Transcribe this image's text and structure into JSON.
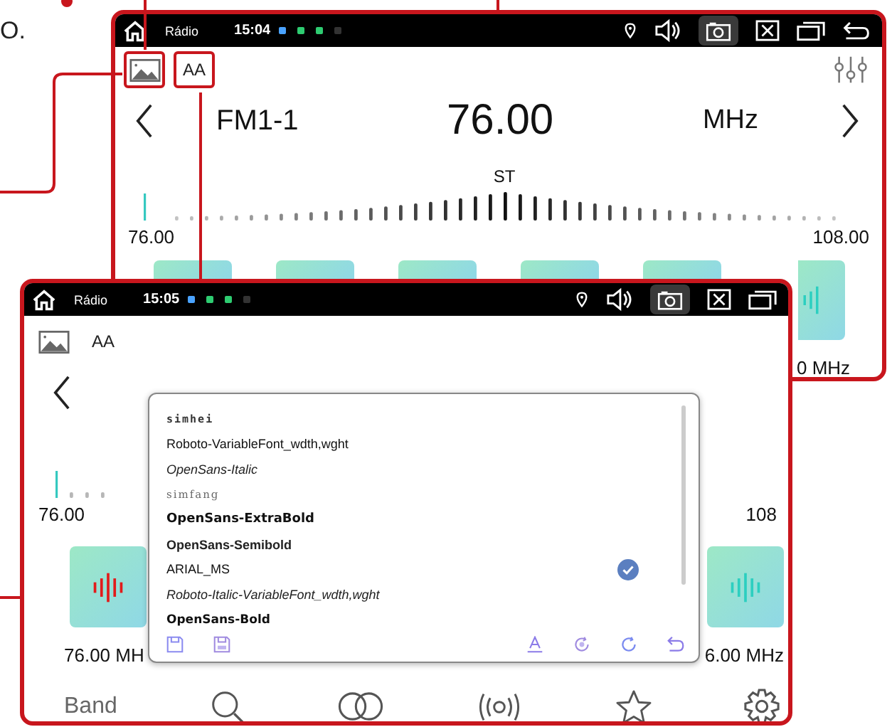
{
  "page_fragment": "O.",
  "back_screen": {
    "status_bar": {
      "app": "Rádio",
      "time": "15:04",
      "icons": [
        {
          "kind": "location"
        },
        {
          "kind": "volume"
        },
        {
          "kind": "camera"
        },
        {
          "kind": "close"
        },
        {
          "kind": "windows"
        },
        {
          "kind": "back"
        }
      ]
    },
    "toolbar": {
      "image_highlighted": true,
      "font_button": "AA",
      "font_highlighted": true
    },
    "band": "FM1-1",
    "frequency": "76.00",
    "unit": "MHz",
    "stereo": "ST",
    "scale": {
      "min": "76.00",
      "max": "108.00",
      "level": 0
    },
    "presets": [
      {
        "kind": "strip"
      },
      {
        "kind": "strip"
      },
      {
        "kind": "strip"
      },
      {
        "kind": "strip"
      },
      {
        "kind": "strip"
      },
      {
        "kind": "tail",
        "label": "0 MHz"
      }
    ]
  },
  "front_screen": {
    "status_bar": {
      "app": "Rádio",
      "time": "15:05",
      "icons": [
        {
          "kind": "location"
        },
        {
          "kind": "volume"
        },
        {
          "kind": "camera"
        },
        {
          "kind": "close"
        },
        {
          "kind": "windows"
        }
      ]
    },
    "toolbar": {
      "image_highlighted": false,
      "font_button": "AA",
      "font_highlighted": false
    },
    "scale": {
      "min": "76.00",
      "max": "108",
      "level": 0
    },
    "presets": [
      {
        "playing": true,
        "label": "76.00 MH"
      },
      {
        "playing": false,
        "label": "6.00 MHz"
      }
    ],
    "nav": [
      {
        "kind": "band",
        "label": "Band"
      },
      {
        "kind": "search"
      },
      {
        "kind": "stereo"
      },
      {
        "kind": "radio"
      },
      {
        "kind": "favorite"
      },
      {
        "kind": "settings"
      }
    ],
    "font_popup": {
      "fonts": [
        {
          "name": "simhei",
          "kind": "mono",
          "selected": false
        },
        {
          "name": "Roboto-VariableFont_wdth,wght",
          "kind": "regular",
          "selected": false
        },
        {
          "name": "OpenSans-Italic",
          "kind": "italic",
          "selected": false
        },
        {
          "name": "simfang",
          "kind": "serif",
          "selected": false
        },
        {
          "name": "OpenSans-ExtraBold",
          "kind": "extrabold",
          "selected": false
        },
        {
          "name": "OpenSans-Semibold",
          "kind": "semibold",
          "selected": false
        },
        {
          "name": "ARIAL_MS",
          "kind": "regular",
          "selected": true
        },
        {
          "name": "Roboto-Italic-VariableFont_wdth,wght",
          "kind": "italic",
          "selected": false
        },
        {
          "name": "OpenSans-Bold",
          "kind": "bold",
          "selected": false
        }
      ],
      "actions": [
        {
          "kind": "save"
        },
        {
          "kind": "save-all"
        },
        {
          "kind": "font"
        },
        {
          "kind": "refresh-all"
        },
        {
          "kind": "refresh"
        },
        {
          "kind": "undo"
        }
      ]
    }
  }
}
